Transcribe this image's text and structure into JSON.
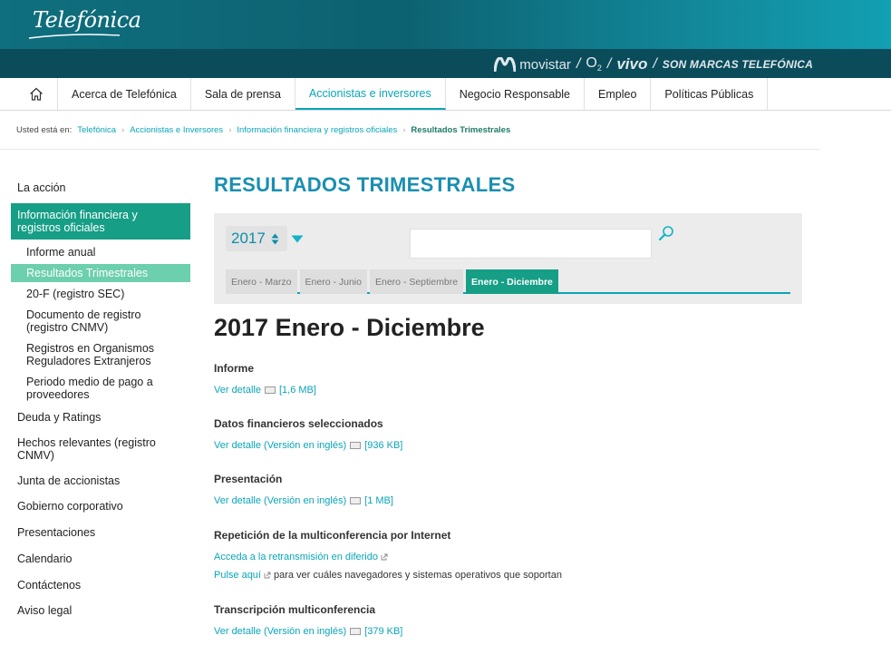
{
  "header": {
    "logo": "Telefónica",
    "brands": {
      "movistar": "movistar",
      "o2": "O",
      "o2_sub": "2",
      "vivo": "vivo",
      "sep": "/",
      "tagline": "SON MARCAS TELEFÓNICA"
    }
  },
  "nav": {
    "home_icon": "home-icon",
    "items": [
      "Acerca de Telefónica",
      "Sala de prensa",
      "Accionistas e inversores",
      "Negocio Responsable",
      "Empleo",
      "Políticas Públicas"
    ],
    "active": "Accionistas e inversores"
  },
  "breadcrumb": {
    "prefix": "Usted está en:",
    "items": [
      "Telefónica",
      "Accionistas e Inversores",
      "Información financiera y registros oficiales",
      "Resultados Trimestrales"
    ],
    "sep": "›"
  },
  "sidebar": {
    "items": [
      "La acción",
      "Información financiera y registros oficiales",
      "Deuda y Ratings",
      "Hechos relevantes (registro CNMV)",
      "Junta de accionistas",
      "Gobierno corporativo",
      "Presentaciones",
      "Calendario",
      "Contáctenos",
      "Aviso legal"
    ],
    "sub": [
      "Informe anual",
      "Resultados Trimestrales",
      "20-F (registro SEC)",
      "Documento de registro (registro CNMV)",
      "Registros en Organismos Reguladores Extranjeros",
      "Periodo medio de pago a proveedores"
    ]
  },
  "main": {
    "title": "RESULTADOS TRIMESTRALES",
    "filter": {
      "year": "2017",
      "search_placeholder": "",
      "tabs": [
        "Enero - Marzo",
        "Enero - Junio",
        "Enero - Septiembre",
        "Enero - Diciembre"
      ],
      "active_tab": "Enero - Diciembre"
    },
    "period_title": "2017 Enero - Diciembre",
    "sections": [
      {
        "heading": "Informe",
        "link": "Ver detalle",
        "size": "[1,6 MB]"
      },
      {
        "heading": "Datos financieros seleccionados",
        "link": "Ver detalle (Versión en inglés)",
        "size": "[936 KB]"
      },
      {
        "heading": "Presentación",
        "link": "Ver detalle (Versión en inglés)",
        "size": "[1 MB]"
      },
      {
        "heading": "Repetición de la multiconferencia por Internet",
        "link": "Acceda a la retransmisión en diferido",
        "link2": "Pulse aquí",
        "text2": "para ver cuáles navegadores y sistemas operativos que soportan"
      },
      {
        "heading": "Transcripción multiconferencia",
        "link": "Ver detalle (Versión en inglés)",
        "size": "[379 KB]"
      }
    ]
  },
  "colors": {
    "accent": "#0aa5b8",
    "green": "#169e86",
    "light_green": "#6ccfae",
    "title_blue": "#1a8fb2"
  }
}
